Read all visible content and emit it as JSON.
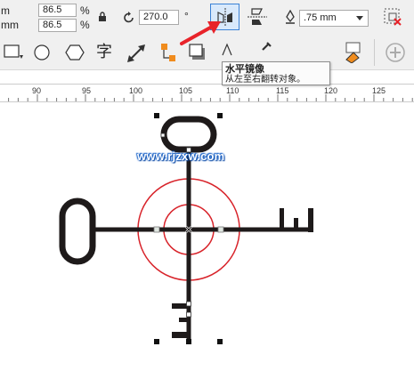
{
  "property_bar": {
    "size_unit_1": "m",
    "size_unit_2": "mm",
    "scale_x": "86.5",
    "scale_y": "86.5",
    "percent_1": "%",
    "percent_2": "%",
    "rotation": "270.0",
    "degree": "°",
    "outline_width": ".75 mm"
  },
  "tooltip": {
    "title": "水平镜像",
    "description": "从左至右翻转对象。"
  },
  "toolbar2": {
    "text_tool_glyph": "字"
  },
  "ruler": {
    "labels": [
      "90",
      "95",
      "100",
      "105",
      "110",
      "115",
      "120",
      "125"
    ]
  },
  "watermark": "www.rjzxw.com",
  "colors": {
    "accent_red": "#e8232a",
    "circle_red": "#d8232a",
    "shape_black": "#1e1a1a",
    "selection_blue": "#3b82d6"
  }
}
